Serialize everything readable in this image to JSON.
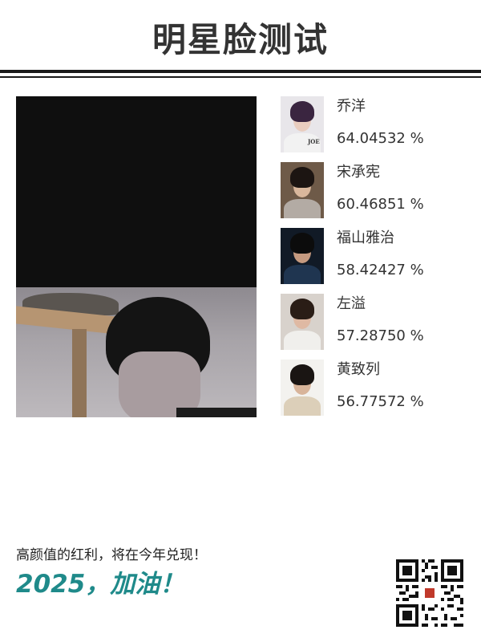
{
  "header": {
    "title": "明星脸测试"
  },
  "matches": [
    {
      "name": "乔洋",
      "score": "64.04532 %",
      "thumb_tag": "JOE"
    },
    {
      "name": "宋承宪",
      "score": "60.46851 %"
    },
    {
      "name": "福山雅治",
      "score": "58.42427 %"
    },
    {
      "name": "左溢",
      "score": "57.28750 %"
    },
    {
      "name": "黄致列",
      "score": "56.77572 %"
    }
  ],
  "footer": {
    "slogan": "高颜值的红利，将在今年兑现！",
    "cheer": "2025，加油！"
  },
  "colors": {
    "accent": "#1f8a8a",
    "rule": "#1a1a1a",
    "text": "#333333"
  },
  "icons": {
    "qr": "qr-code-icon"
  }
}
